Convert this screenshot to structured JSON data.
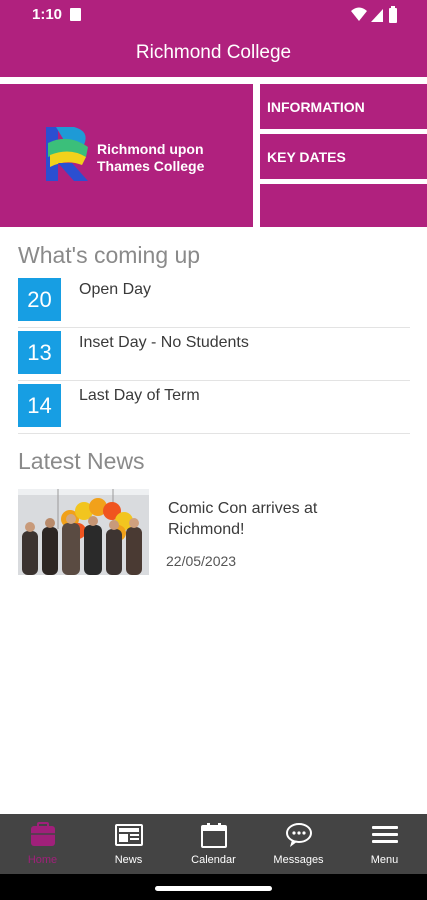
{
  "status_bar": {
    "time": "1:10"
  },
  "header": {
    "title": "Richmond College"
  },
  "tiles": {
    "logo_text_line1": "Richmond upon",
    "logo_text_line2": "Thames College",
    "information": "INFORMATION",
    "key_dates": "KEY DATES"
  },
  "coming_up": {
    "title": "What's coming up",
    "events": [
      {
        "day": "20",
        "name": "Open Day"
      },
      {
        "day": "13",
        "name": "Inset Day - No Students"
      },
      {
        "day": "14",
        "name": "Last Day of Term"
      }
    ]
  },
  "news": {
    "title": "Latest News",
    "items": [
      {
        "headline": "Comic Con arrives at Richmond!",
        "date": "22/05/2023"
      }
    ]
  },
  "bottom_nav": {
    "items": [
      {
        "label": "Home",
        "icon": "home-icon"
      },
      {
        "label": "News",
        "icon": "news-icon"
      },
      {
        "label": "Calendar",
        "icon": "calendar-icon"
      },
      {
        "label": "Messages",
        "icon": "messages-icon"
      },
      {
        "label": "Menu",
        "icon": "menu-icon"
      }
    ]
  },
  "colors": {
    "brand": "#b0217e",
    "event_badge": "#179ee3",
    "nav_background": "#444444",
    "nav_active": "#a0207a"
  }
}
